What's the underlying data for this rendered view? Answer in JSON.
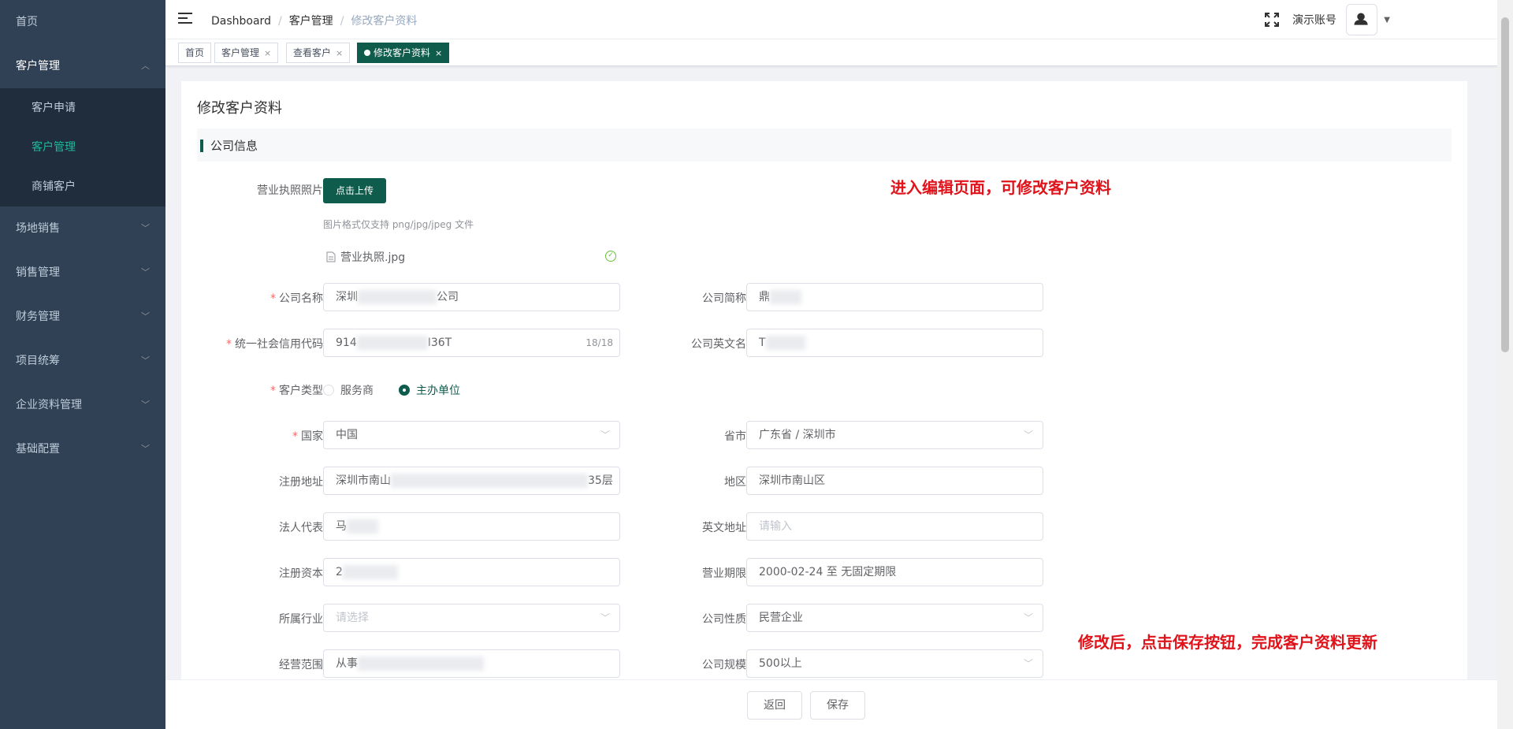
{
  "sidebar": {
    "home": "首页",
    "customer_mgmt": "客户管理",
    "customer_sub": [
      "客户申请",
      "客户管理",
      "商铺客户"
    ],
    "menus": [
      "场地销售",
      "销售管理",
      "财务管理",
      "项目统筹",
      "企业资料管理",
      "基础配置"
    ]
  },
  "header": {
    "breadcrumb": [
      "Dashboard",
      "客户管理",
      "修改客户资料"
    ],
    "account": "演示账号"
  },
  "tags": [
    "首页",
    "客户管理",
    "查看客户",
    "修改客户资料"
  ],
  "page": {
    "title": "修改客户资料",
    "section": "公司信息"
  },
  "upload": {
    "label": "营业执照照片",
    "button": "点击上传",
    "tip": "图片格式仅支持 png/jpg/jpeg 文件",
    "file": "营业执照.jpg"
  },
  "form": {
    "company_name": {
      "label": "公司名称",
      "prefix": "深圳",
      "suffix": "公司"
    },
    "short_name": {
      "label": "公司简称",
      "prefix": "鼎"
    },
    "credit_code": {
      "label": "统一社会信用代码",
      "prefix": "914",
      "suffix": "I36T",
      "counter": "18/18"
    },
    "english_name": {
      "label": "公司英文名",
      "prefix": "T"
    },
    "customer_type": {
      "label": "客户类型",
      "options": [
        "服务商",
        "主办单位"
      ],
      "selected": "主办单位"
    },
    "country": {
      "label": "国家",
      "value": "中国"
    },
    "province": {
      "label": "省市",
      "value": "广东省 / 深圳市"
    },
    "reg_address": {
      "label": "注册地址",
      "prefix": "深圳市南山",
      "suffix": "35层"
    },
    "district": {
      "label": "地区",
      "value": "深圳市南山区"
    },
    "legal_rep": {
      "label": "法人代表",
      "prefix": "马"
    },
    "english_address": {
      "label": "英文地址",
      "placeholder": "请输入"
    },
    "reg_capital": {
      "label": "注册资本",
      "prefix": "2"
    },
    "business_term": {
      "label": "营业期限",
      "value": "2000-02-24 至 无固定期限"
    },
    "industry": {
      "label": "所属行业",
      "placeholder": "请选择"
    },
    "company_nature": {
      "label": "公司性质",
      "value": "民营企业"
    },
    "business_scope": {
      "label": "经营范围",
      "prefix": "从事"
    },
    "company_size": {
      "label": "公司规模",
      "value": "500以上"
    }
  },
  "annotations": {
    "top": "进入编辑页面，可修改客户资料",
    "bottom": "修改后，点击保存按钮，完成客户资料更新"
  },
  "footer": {
    "back": "返回",
    "save": "保存"
  },
  "colors": {
    "accent": "#0f5c4d",
    "sidebar": "#304156",
    "active_menu": "#1fb89a",
    "annotation": "#e0131b"
  }
}
